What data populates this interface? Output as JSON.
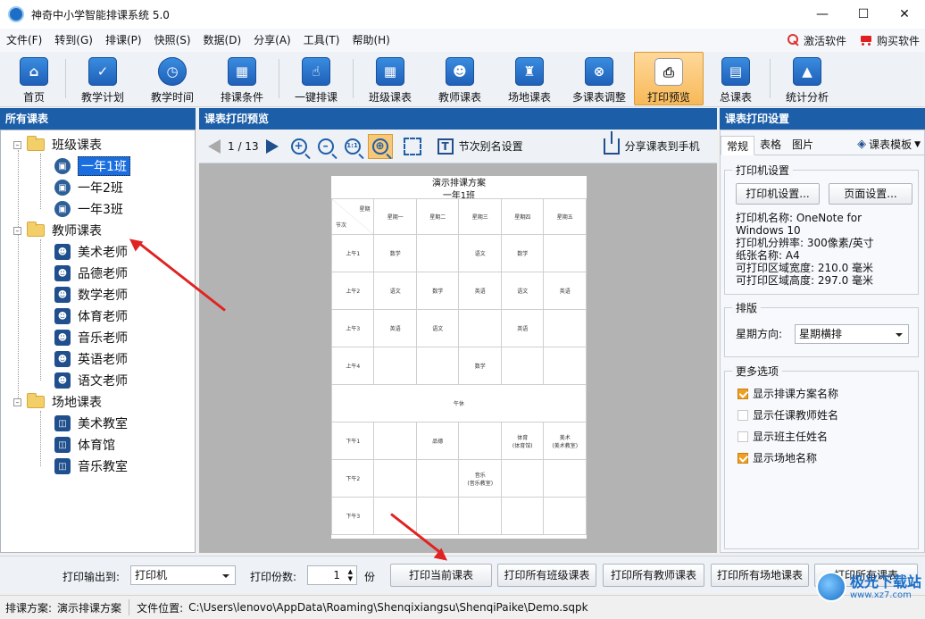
{
  "window": {
    "title": "神奇中小学智能排课系统 5.0"
  },
  "menu": {
    "items": [
      "文件(F)",
      "转到(G)",
      "排课(P)",
      "快照(S)",
      "数据(D)",
      "分享(A)",
      "工具(T)",
      "帮助(H)"
    ],
    "activate": "激活软件",
    "buy": "购买软件"
  },
  "toolbar": {
    "items": [
      {
        "label": "首页",
        "icon": "home-icon"
      },
      {
        "label": "教学计划",
        "icon": "clipboard-icon"
      },
      {
        "label": "教学时间",
        "icon": "clock-icon"
      },
      {
        "label": "排课条件",
        "icon": "cubes-icon"
      },
      {
        "label": "一键排课",
        "icon": "hand-pointer-icon"
      },
      {
        "label": "班级课表",
        "icon": "grid-calendar-icon"
      },
      {
        "label": "教师课表",
        "icon": "teacher-icon"
      },
      {
        "label": "场地课表",
        "icon": "building-icon"
      },
      {
        "label": "多课表调整",
        "icon": "schedule-adjust-icon"
      },
      {
        "label": "打印预览",
        "icon": "printer-icon"
      },
      {
        "label": "总课表",
        "icon": "calendar-icon"
      },
      {
        "label": "统计分析",
        "icon": "chart-icon"
      }
    ]
  },
  "left": {
    "header": "所有课表",
    "groups": [
      {
        "label": "班级课表",
        "items": [
          "一年1班",
          "一年2班",
          "一年3班"
        ]
      },
      {
        "label": "教师课表",
        "items": [
          "美术老师",
          "品德老师",
          "数学老师",
          "体育老师",
          "音乐老师",
          "英语老师",
          "语文老师"
        ]
      },
      {
        "label": "场地课表",
        "items": [
          "美术教室",
          "体育馆",
          "音乐教室"
        ]
      }
    ]
  },
  "center": {
    "header": "课表打印预览",
    "page_indicator": "1 / 13",
    "alias_setting": "节次别名设置",
    "share": "分享课表到手机",
    "zoom_actual": "1:1",
    "preview": {
      "title": "演示排课方案",
      "subtitle": "一年1班",
      "corner_top": "星期",
      "corner_bottom": "节次",
      "days": [
        "星期一",
        "星期二",
        "星期三",
        "星期四",
        "星期五"
      ],
      "rows": [
        {
          "period": "上午1",
          "cells": [
            "数学",
            "",
            "语文",
            "数学",
            ""
          ]
        },
        {
          "period": "上午2",
          "cells": [
            "语文",
            "数学",
            "英语",
            "语文",
            "英语"
          ]
        },
        {
          "period": "上午3",
          "cells": [
            "英语",
            "语文",
            "",
            "英语",
            ""
          ]
        },
        {
          "period": "上午4",
          "cells": [
            "",
            "",
            "数学",
            "",
            ""
          ]
        },
        {
          "period": "",
          "cells": [
            "",
            "",
            "午休",
            "",
            ""
          ]
        },
        {
          "period": "下午1",
          "cells": [
            "",
            "品德",
            "",
            "体育\n(体育馆)",
            "美术\n(美术教室)"
          ]
        },
        {
          "period": "下午2",
          "cells": [
            "",
            "",
            "音乐\n(音乐教室)",
            "",
            ""
          ]
        },
        {
          "period": "下午3",
          "cells": [
            "",
            "",
            "",
            "",
            ""
          ]
        }
      ]
    }
  },
  "right": {
    "header": "课表打印设置",
    "tabs": [
      "常规",
      "表格",
      "图片"
    ],
    "template": "课表模板",
    "printer_group": "打印机设置",
    "printer_btn": "打印机设置...",
    "page_btn": "页面设置...",
    "info": [
      "打印机名称: OneNote for",
      "Windows 10",
      "打印机分辨率: 300像素/英寸",
      "纸张名称: A4",
      "可打印区域宽度: 210.0 毫米",
      "可打印区域高度: 297.0 毫米"
    ],
    "layout_group": "排版",
    "direction_label": "星期方向:",
    "direction_value": "星期横排",
    "more_group": "更多选项",
    "options": [
      {
        "label": "显示排课方案名称",
        "checked": true
      },
      {
        "label": "显示任课教师姓名",
        "checked": false
      },
      {
        "label": "显示班主任姓名",
        "checked": false
      },
      {
        "label": "显示场地名称",
        "checked": true
      }
    ]
  },
  "bottom": {
    "output_label": "打印输出到:",
    "output_value": "打印机",
    "copies_label": "打印份数:",
    "copies_value": "1",
    "copies_unit": "份",
    "buttons": [
      "打印当前课表",
      "打印所有班级课表",
      "打印所有教师课表",
      "打印所有场地课表",
      "打印所有课表"
    ]
  },
  "status": {
    "plan_label": "排课方案:",
    "plan_value": "演示排课方案",
    "file_label": "文件位置:",
    "file_value": "C:\\Users\\lenovo\\AppData\\Roaming\\Shenqixiangsu\\ShenqiPaike\\Demo.sqpk"
  },
  "watermark": {
    "line1": "极光下载站",
    "line2": "www.xz7.com"
  }
}
